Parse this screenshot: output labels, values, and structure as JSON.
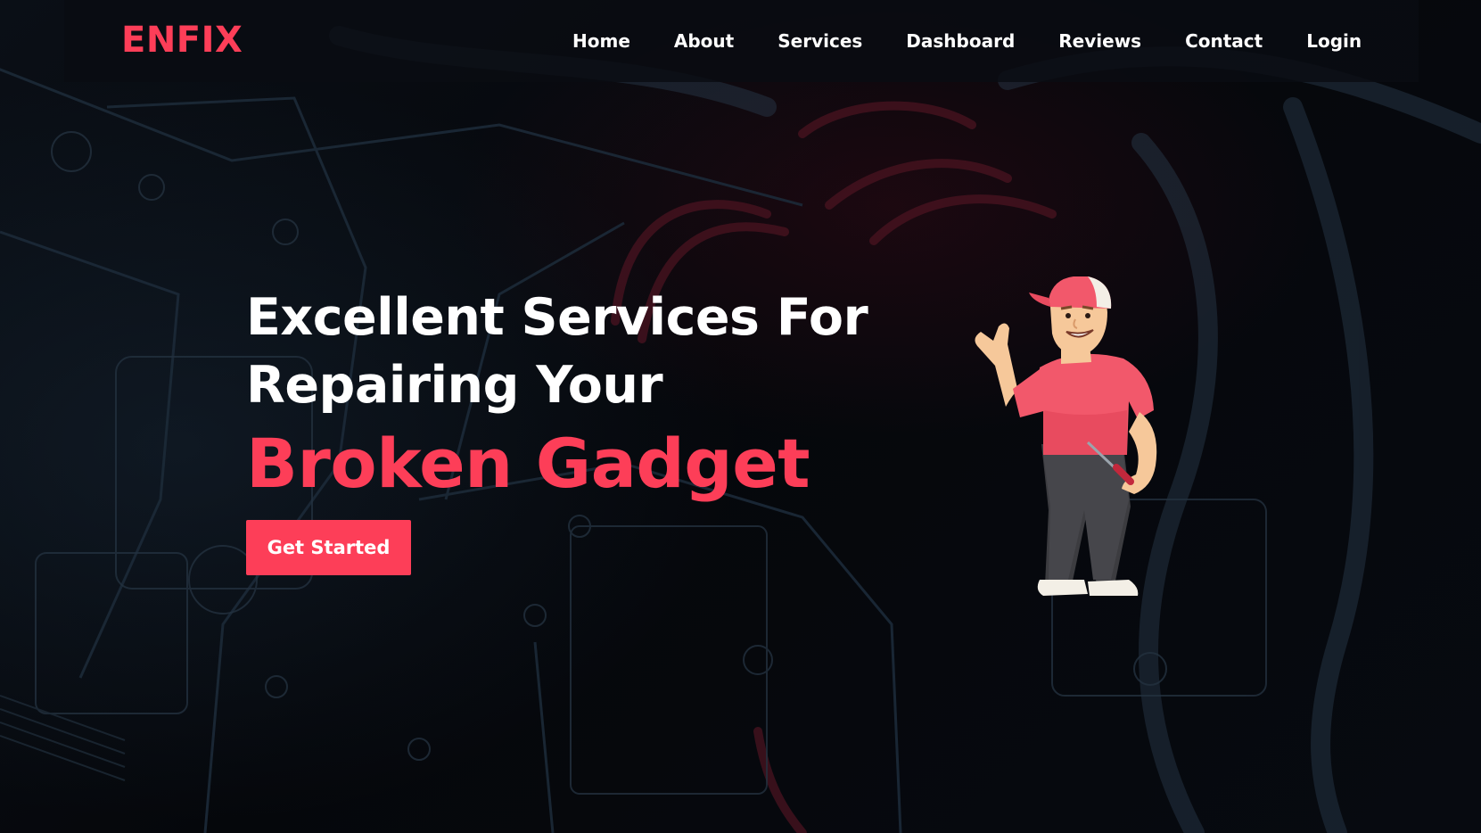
{
  "brand": {
    "logo": "ENFIX",
    "accent_color": "#fd3e58"
  },
  "nav": {
    "items": [
      {
        "label": "Home"
      },
      {
        "label": "About"
      },
      {
        "label": "Services"
      },
      {
        "label": "Dashboard"
      },
      {
        "label": "Reviews"
      },
      {
        "label": "Contact"
      },
      {
        "label": "Login"
      }
    ]
  },
  "hero": {
    "line1": "Excellent Services For",
    "line2": "Repairing Your",
    "accent": "Broken Gadget",
    "cta_label": "Get Started"
  },
  "illustration": {
    "icon": "repairman-mascot-icon"
  }
}
